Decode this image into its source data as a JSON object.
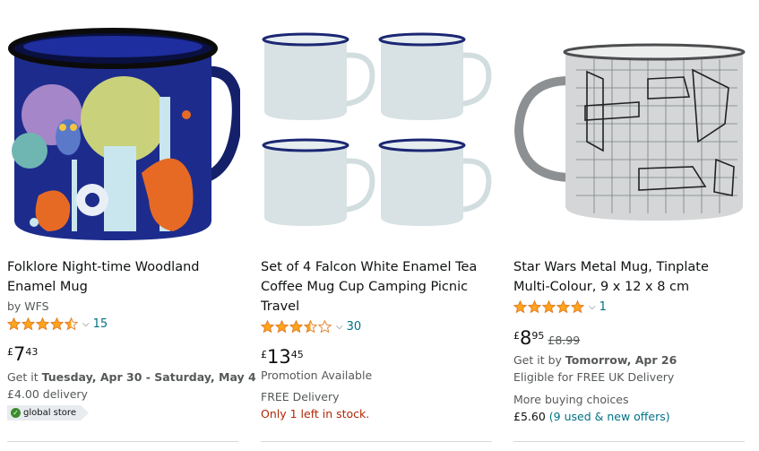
{
  "colors": {
    "link": "#007185",
    "star": "#ffa41c",
    "alert": "#b12704"
  },
  "products": [
    {
      "title": "Folklore Night-time Woodland Enamel Mug",
      "by": "by WFS",
      "rating": 4.5,
      "review_count": "15",
      "price": {
        "symbol": "£",
        "whole": "7",
        "fraction": "43"
      },
      "delivery_prefix": "Get it ",
      "delivery_date": "Tuesday, Apr 30 - Saturday, May 4",
      "delivery_fee": "£4.00 delivery",
      "badge": "global store"
    },
    {
      "title": "Set of 4 Falcon White Enamel Tea Coffee Mug Cup Camping Picnic Travel",
      "rating": 3.5,
      "review_count": "30",
      "price": {
        "symbol": "£",
        "whole": "13",
        "fraction": "45"
      },
      "promotion": "Promotion Available",
      "delivery": "FREE Delivery",
      "stock": "Only 1 left in stock."
    },
    {
      "title": "Star Wars Metal Mug, Tinplate Multi-Colour, 9 x 12 x 8 cm",
      "rating": 5,
      "review_count": "1",
      "price": {
        "symbol": "£",
        "whole": "8",
        "fraction": "95"
      },
      "was_price": "£8.99",
      "delivery_prefix": "Get it by ",
      "delivery_date": "Tomorrow, Apr 26",
      "delivery_note": "Eligible for FREE UK Delivery",
      "more_choices": "More buying choices",
      "offer_price": "£5.60",
      "offer_link": "(9 used & new offers)"
    }
  ]
}
